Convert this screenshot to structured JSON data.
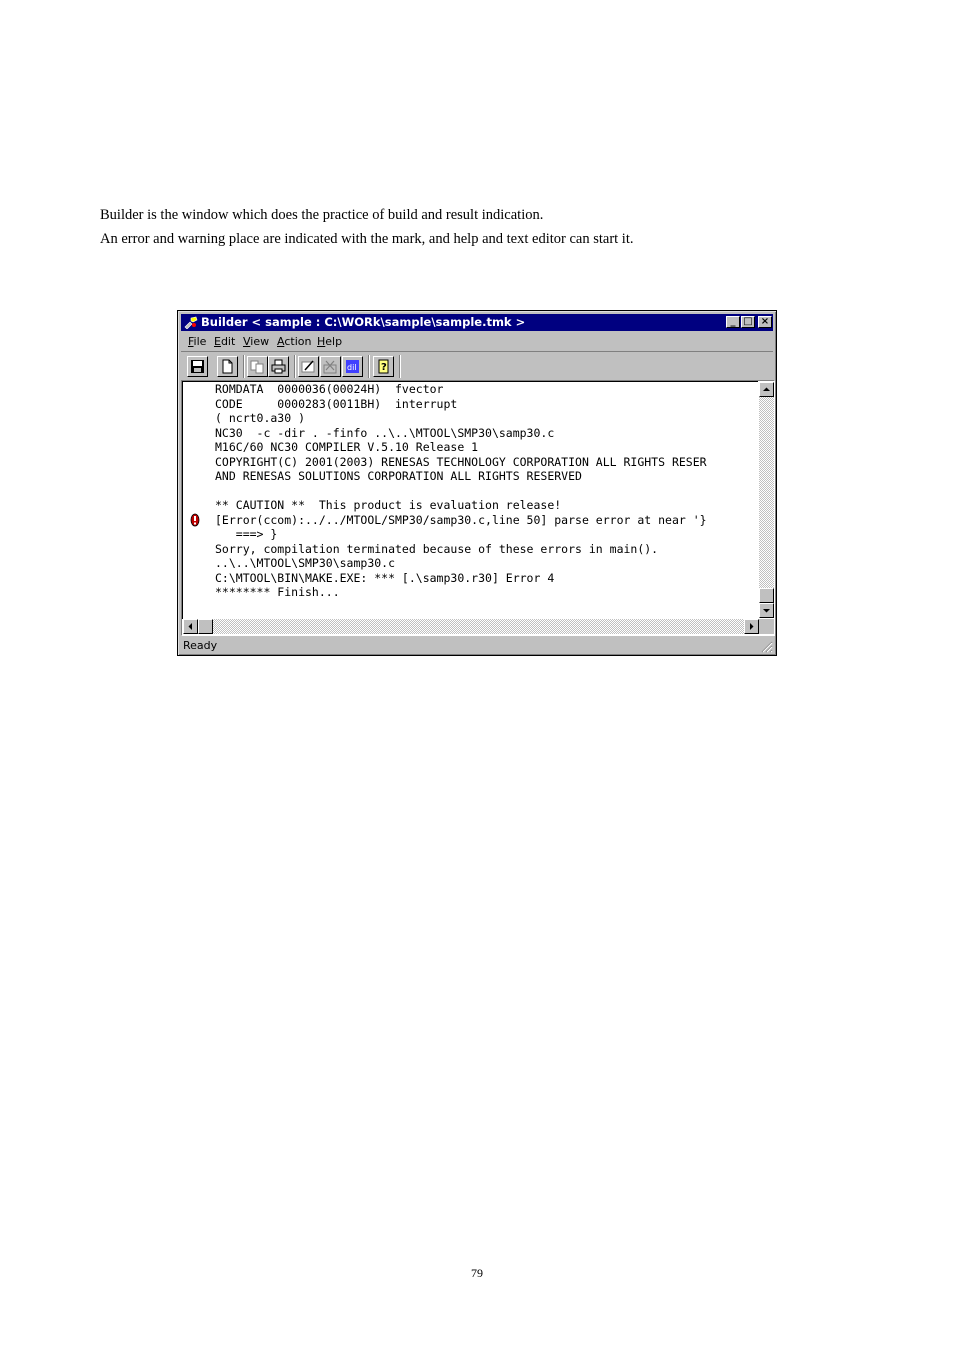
{
  "document": {
    "paragraph1": "Builder is the window which does the practice of build and result indication.",
    "paragraph2": "An error and warning place are indicated with the mark, and help and text editor can start it.",
    "page_number": "79"
  },
  "window": {
    "title": "Builder < sample : C:\\WORk\\sample\\sample.tmk >",
    "controls": [
      "_",
      "□",
      "×"
    ],
    "menu": [
      {
        "label": "File",
        "mnemonic": "F",
        "rest": "ile"
      },
      {
        "label": "Edit",
        "mnemonic": "E",
        "rest": "dit"
      },
      {
        "label": "View",
        "mnemonic": "V",
        "rest": "iew"
      },
      {
        "label": "Action",
        "mnemonic": "A",
        "rest": "ction"
      },
      {
        "label": "Help",
        "mnemonic": "H",
        "rest": "elp"
      }
    ],
    "toolbar_icons": [
      "save-icon",
      "new-file-icon",
      "copy-icon",
      "print-icon",
      "edit-icon",
      "clear-icon",
      "find-icon",
      "help-icon"
    ],
    "output_lines": [
      "ROMDATA  0000036(00024H)  fvector",
      "CODE     0000283(0011BH)  interrupt",
      "( ncrt0.a30 )",
      "NC30  -c -dir . -finfo ..\\..\\MTOOL\\SMP30\\samp30.c",
      "M16C/60 NC30 COMPILER V.5.10 Release 1",
      "COPYRIGHT(C) 2001(2003) RENESAS TECHNOLOGY CORPORATION ALL RIGHTS RESER",
      "AND RENESAS SOLUTIONS CORPORATION ALL RIGHTS RESERVED",
      "",
      "** CAUTION **  This product is evaluation release!",
      "[Error(ccom):../../MTOOL/SMP30/samp30.c,line 50] parse error at near '}",
      "   ===> }",
      "Sorry, compilation terminated because of these errors in main().",
      "..\\..\\MTOOL\\SMP30\\samp30.c",
      "C:\\MTOOL\\BIN\\MAKE.EXE: *** [.\\samp30.r30] Error 4",
      "******** Finish..."
    ],
    "status": "Ready"
  }
}
